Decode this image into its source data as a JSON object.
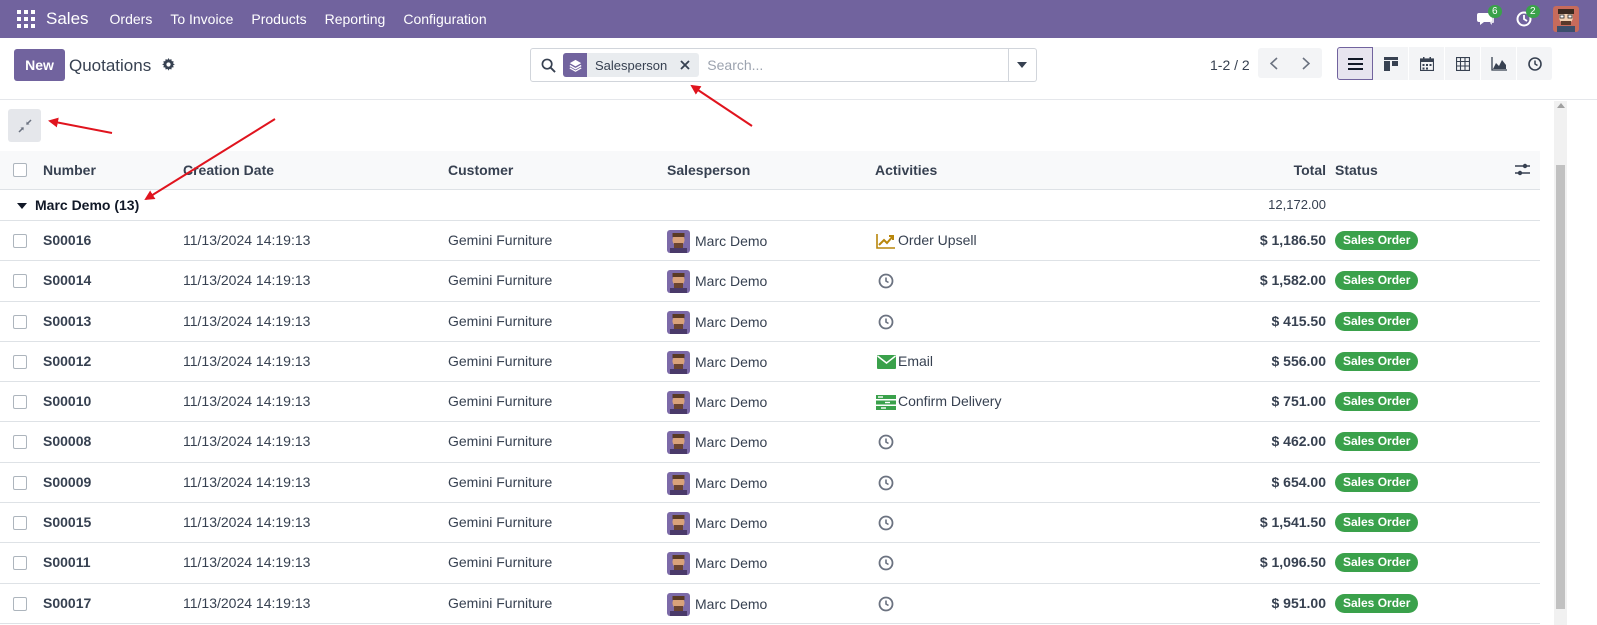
{
  "navbar": {
    "app_name": "Sales",
    "menu": [
      "Orders",
      "To Invoice",
      "Products",
      "Reporting",
      "Configuration"
    ],
    "messages_count": "6",
    "activities_count": "2",
    "color": "#71639e"
  },
  "control": {
    "new_label": "New",
    "title": "Quotations",
    "facet_label": "Salesperson",
    "search_placeholder": "Search...",
    "pager": "1-2 / 2",
    "views": [
      "list-icon",
      "kanban-icon",
      "calendar-icon",
      "pivot-icon",
      "graph-icon",
      "activity-icon"
    ]
  },
  "table": {
    "columns": {
      "number": "Number",
      "date": "Creation Date",
      "customer": "Customer",
      "salesperson": "Salesperson",
      "activities": "Activities",
      "total": "Total",
      "status": "Status"
    },
    "group": {
      "label": "Marc Demo (13)",
      "total": "12,172.00"
    },
    "rows": [
      {
        "number": "S00016",
        "date": "11/13/2024 14:19:13",
        "customer": "Gemini Furniture",
        "salesperson": "Marc Demo",
        "activity_icon": "upsell-icon",
        "activity": "Order Upsell",
        "total": "$ 1,186.50",
        "status": "Sales Order"
      },
      {
        "number": "S00014",
        "date": "11/13/2024 14:19:13",
        "customer": "Gemini Furniture",
        "salesperson": "Marc Demo",
        "activity_icon": "clock-icon",
        "activity": "",
        "total": "$ 1,582.00",
        "status": "Sales Order"
      },
      {
        "number": "S00013",
        "date": "11/13/2024 14:19:13",
        "customer": "Gemini Furniture",
        "salesperson": "Marc Demo",
        "activity_icon": "clock-icon",
        "activity": "",
        "total": "$ 415.50",
        "status": "Sales Order"
      },
      {
        "number": "S00012",
        "date": "11/13/2024 14:19:13",
        "customer": "Gemini Furniture",
        "salesperson": "Marc Demo",
        "activity_icon": "email-icon",
        "activity": "Email",
        "total": "$ 556.00",
        "status": "Sales Order"
      },
      {
        "number": "S00010",
        "date": "11/13/2024 14:19:13",
        "customer": "Gemini Furniture",
        "salesperson": "Marc Demo",
        "activity_icon": "delivery-icon",
        "activity": "Confirm Delivery",
        "total": "$ 751.00",
        "status": "Sales Order"
      },
      {
        "number": "S00008",
        "date": "11/13/2024 14:19:13",
        "customer": "Gemini Furniture",
        "salesperson": "Marc Demo",
        "activity_icon": "clock-icon",
        "activity": "",
        "total": "$ 462.00",
        "status": "Sales Order"
      },
      {
        "number": "S00009",
        "date": "11/13/2024 14:19:13",
        "customer": "Gemini Furniture",
        "salesperson": "Marc Demo",
        "activity_icon": "clock-icon",
        "activity": "",
        "total": "$ 654.00",
        "status": "Sales Order"
      },
      {
        "number": "S00015",
        "date": "11/13/2024 14:19:13",
        "customer": "Gemini Furniture",
        "salesperson": "Marc Demo",
        "activity_icon": "clock-icon",
        "activity": "",
        "total": "$ 1,541.50",
        "status": "Sales Order"
      },
      {
        "number": "S00011",
        "date": "11/13/2024 14:19:13",
        "customer": "Gemini Furniture",
        "salesperson": "Marc Demo",
        "activity_icon": "clock-icon",
        "activity": "",
        "total": "$ 1,096.50",
        "status": "Sales Order"
      },
      {
        "number": "S00017",
        "date": "11/13/2024 14:19:13",
        "customer": "Gemini Furniture",
        "salesperson": "Marc Demo",
        "activity_icon": "clock-icon",
        "activity": "",
        "total": "$ 951.00",
        "status": "Sales Order"
      }
    ]
  }
}
